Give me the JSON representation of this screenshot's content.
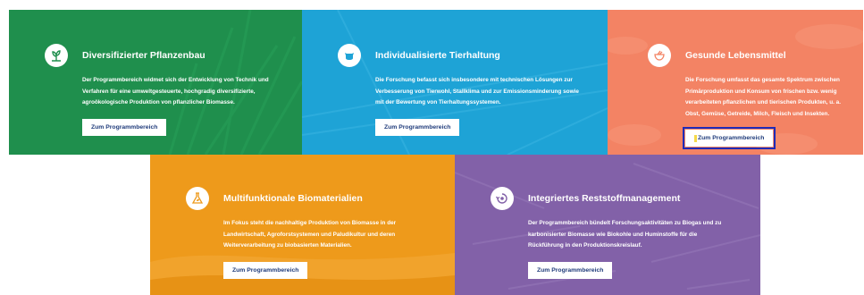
{
  "tiles": [
    {
      "title": "Diversifizierter Pflanzenbau",
      "description": "Der Programmbereich widmet sich der Entwicklung von Technik und Verfahren für eine umweltgesteuerte, hochgradig diversifizierte, agroökologische Produktion von pflanzlicher Biomasse.",
      "button_label": "Zum Programmbereich",
      "icon": "plant-icon",
      "color": "#1f8f4d"
    },
    {
      "title": "Individualisierte Tierhaltung",
      "description": "Die Forschung befasst sich insbesondere mit technischen Lösungen zur Verbesserung von Tierwohl, Stallklima und zur Emissionsminderung sowie mit der Bewertung von Tierhaltungssystemen.",
      "button_label": "Zum Programmbereich",
      "icon": "cow-icon",
      "color": "#1ea3d6"
    },
    {
      "title": "Gesunde Lebensmittel",
      "description": "Die Forschung umfasst das gesamte Spektrum zwischen Primärproduktion und Konsum von frischen bzw. wenig verarbeiteten pflanzlichen und tierischen Produkten, u. a. Obst, Gemüse, Getreide, Milch, Fleisch und Insekten.",
      "button_label": "Zum Programmbereich",
      "icon": "food-bowl-icon",
      "color": "#f38364"
    },
    {
      "title": "Multifunktionale Biomaterialien",
      "description": "Im Fokus steht die nachhaltige Produktion von Biomasse in der Landwirtschaft, Agroforstsystemen und Paludikultur und deren Weiterverarbeitung zu biobasierten Materialien.",
      "button_label": "Zum Programmbereich",
      "icon": "flask-leaf-icon",
      "color": "#ee9a1b"
    },
    {
      "title": "Integriertes Reststoffmanagement",
      "description": "Der Programmbereich bündelt Forschungsaktivitäten zu Biogas und zu karbonisierter Biomasse wie Biokohle und Huminstoffe für die Rückführung in den Produktionskreislauf.",
      "button_label": "Zum Programmbereich",
      "icon": "recycle-icon",
      "color": "#8261a8"
    }
  ]
}
